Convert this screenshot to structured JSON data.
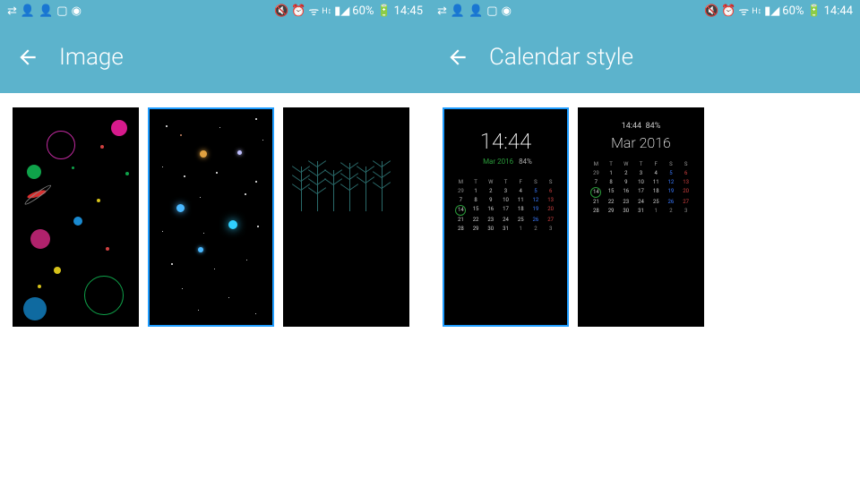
{
  "left": {
    "status": {
      "battery": "60%",
      "time": "14:45"
    },
    "title": "Image"
  },
  "right": {
    "status": {
      "battery": "60%",
      "time": "14:44"
    },
    "title": "Calendar style",
    "cal_a": {
      "clock": "14:44",
      "month": "Mar 2016",
      "batt": "84%",
      "dow": [
        "M",
        "T",
        "W",
        "T",
        "F",
        "S",
        "S"
      ]
    },
    "cal_b": {
      "clock": "14:44",
      "month": "Mar 2016",
      "batt": "84%",
      "dow": [
        "M",
        "T",
        "W",
        "T",
        "F",
        "S",
        "S"
      ]
    }
  }
}
